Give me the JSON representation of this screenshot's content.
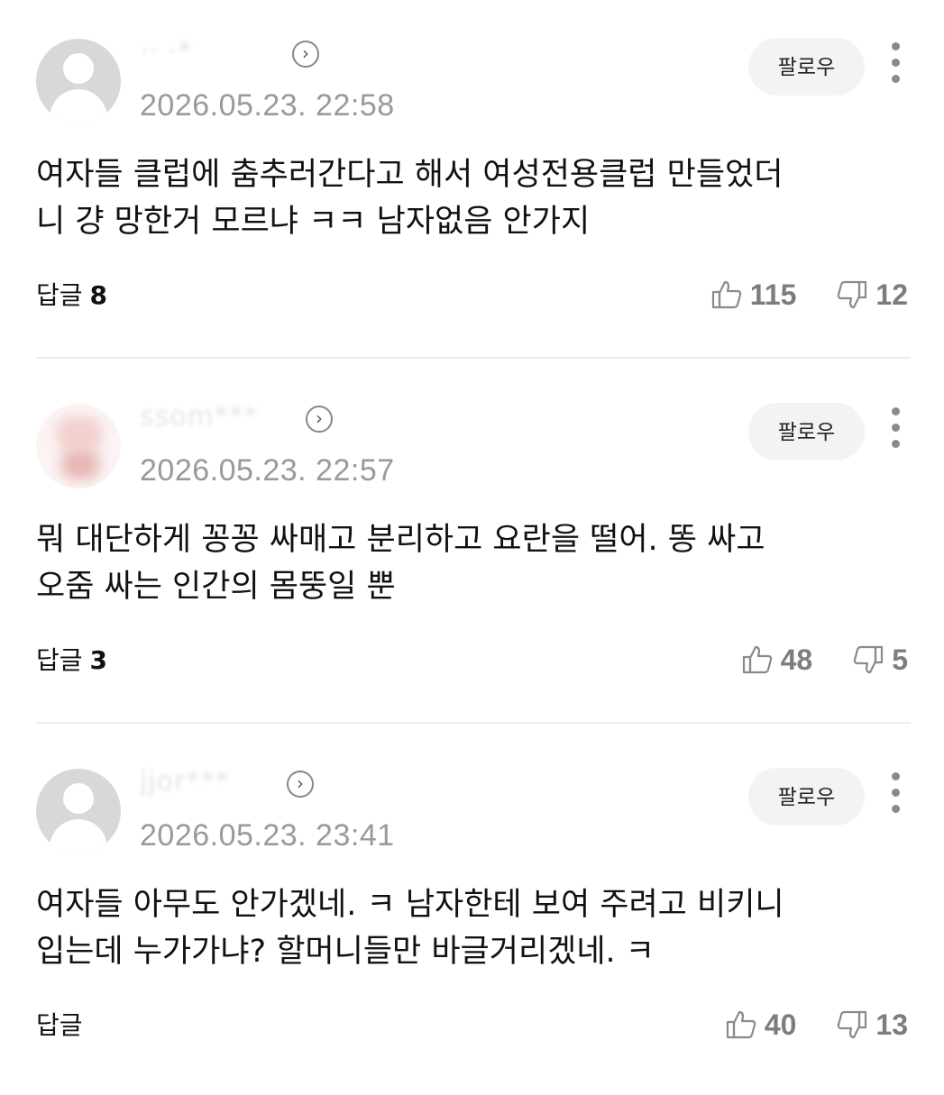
{
  "ui": {
    "follow_label": "팔로우",
    "reply_label": "답글"
  },
  "comments": [
    {
      "username": "·· ·*",
      "timestamp": "2026.05.23. 22:58",
      "text": "여자들 클럽에 춤추러간다고 해서 여성전용클럽 만들었더\n니 걍 망한거 모르냐 ㅋㅋ 남자없음 안가지",
      "reply_count": "8",
      "likes": "115",
      "dislikes": "12",
      "avatar_icon": "default-user-icon"
    },
    {
      "username": "ssom***",
      "timestamp": "2026.05.23. 22:57",
      "text": "뭐 대단하게 꽁꽁 싸매고 분리하고 요란을 떨어. 똥 싸고\n오줌 싸는 인간의 몸뚱일 뿐",
      "reply_count": "3",
      "likes": "48",
      "dislikes": "5",
      "avatar_icon": "profile-photo"
    },
    {
      "username": "jjor***",
      "timestamp": "2026.05.23. 23:41",
      "text": "여자들 아무도 안가겠네. ㅋ 남자한테 보여 주려고 비키니\n입는데 누가가냐? 할머니들만 바글거리겠네. ㅋ",
      "reply_count": "",
      "likes": "40",
      "dislikes": "13",
      "avatar_icon": "default-user-icon"
    }
  ],
  "colors": {
    "timestamp": "#9a9a9a",
    "vote": "#7d7d7d",
    "follow_bg": "#f3f3f3",
    "divider": "#ebebeb"
  }
}
